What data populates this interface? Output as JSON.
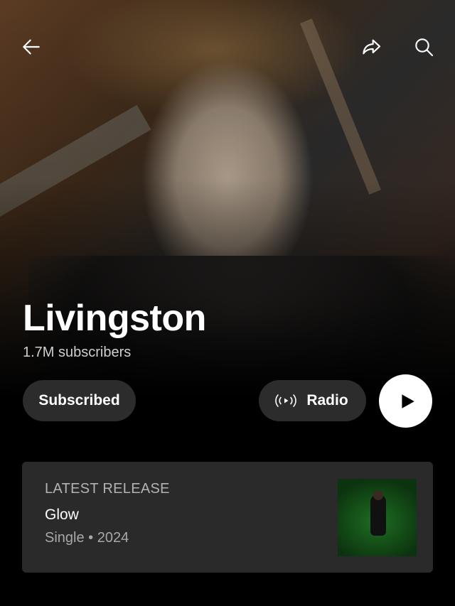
{
  "header": {
    "back_icon": "arrow-left-icon",
    "share_icon": "share-icon",
    "search_icon": "search-icon"
  },
  "artist": {
    "name": "Livingston",
    "subscribers": "1.7M subscribers"
  },
  "actions": {
    "subscribe_label": "Subscribed",
    "radio_label": "Radio",
    "radio_icon": "radio-broadcast-icon",
    "play_icon": "play-icon"
  },
  "latest_release": {
    "section_label": "LATEST RELEASE",
    "title": "Glow",
    "meta": "Single • 2024"
  },
  "colors": {
    "background": "#000000",
    "pill": "#2c2c2c",
    "card": "#2a2a2a",
    "play_button": "#ffffff"
  }
}
